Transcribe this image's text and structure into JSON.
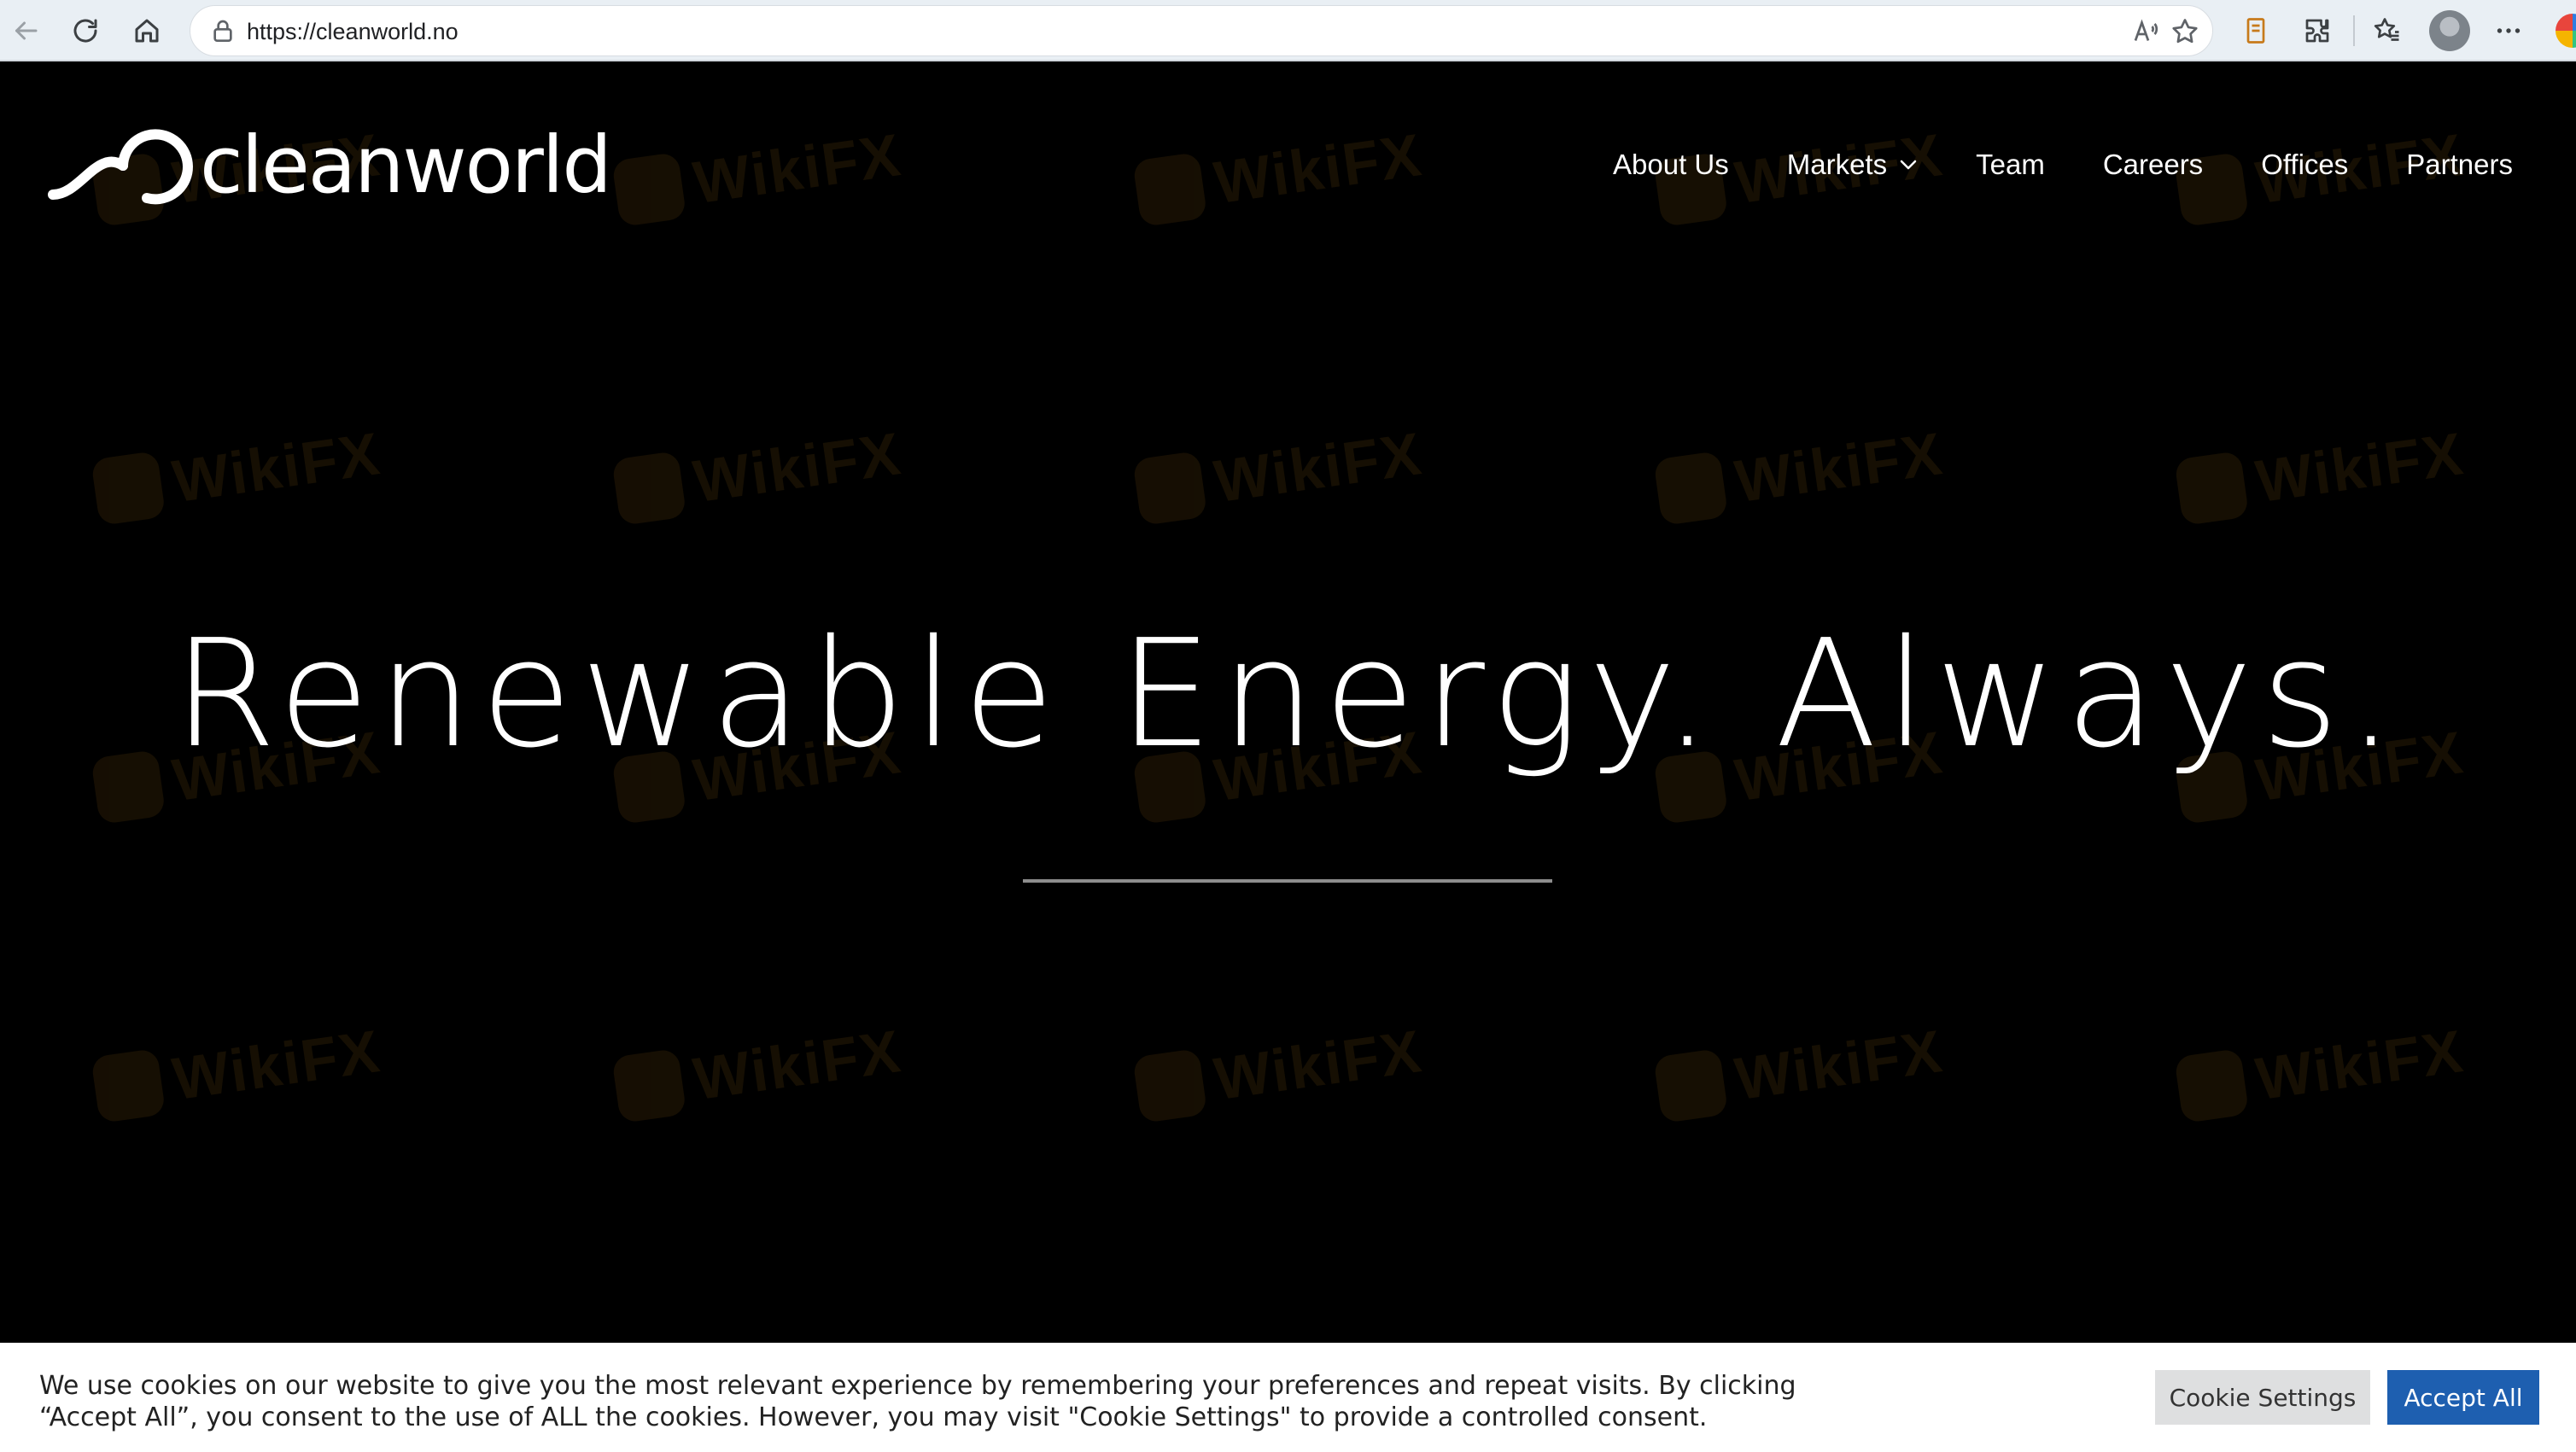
{
  "browser": {
    "url": "https://cleanworld.no",
    "icons": [
      "back-arrow-icon",
      "refresh-icon",
      "home-icon",
      "lock-icon",
      "read-aloud-icon",
      "star-icon",
      "collections-icon",
      "extensions-icon",
      "favorites-icon",
      "profile-avatar",
      "more-icon"
    ]
  },
  "site": {
    "logo_text": "cleanworld",
    "nav": {
      "about": "About Us",
      "markets": "Markets",
      "team": "Team",
      "careers": "Careers",
      "offices": "Offices",
      "partners": "Partners"
    },
    "hero_title": "Renewable Energy. Always."
  },
  "watermark": {
    "text": "WikiFX",
    "color": "#f0a020"
  },
  "cookie": {
    "message": "We use cookies on our website to give you the most relevant experience by remembering your preferences and repeat visits. By clicking “Accept All”, you consent to the use of ALL the cookies. However, you may visit \"Cookie Settings\" to provide a controlled consent.",
    "settings_label": "Cookie Settings",
    "accept_label": "Accept All"
  },
  "colors": {
    "page_bg": "#000000",
    "browser_bar": "#e9eff4",
    "accept_button": "#1e5fb0",
    "settings_button": "#dedfe0"
  }
}
